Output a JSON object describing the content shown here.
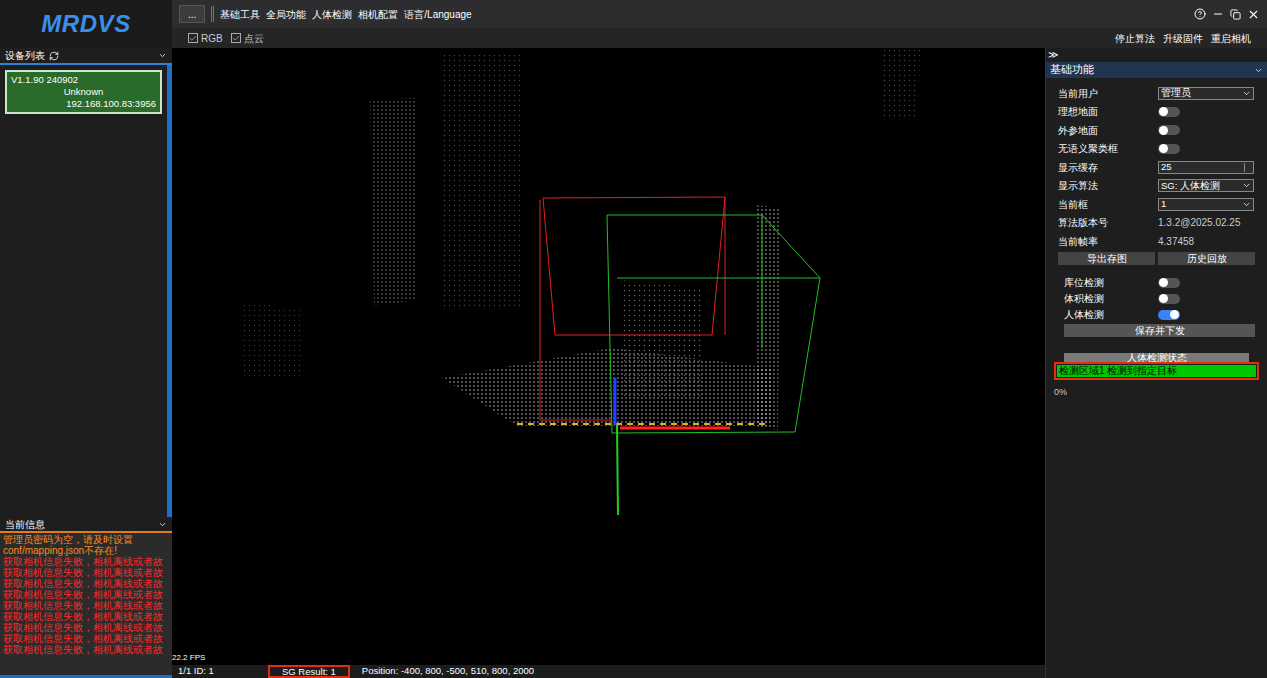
{
  "logo": "MRDVS",
  "device_list": {
    "title": "设备列表",
    "devices": [
      {
        "lines": [
          "V1.1.90 240902",
          "Unknown",
          "192.168.100.83:3956"
        ],
        "selected": true
      }
    ]
  },
  "log": {
    "title": "当前信息",
    "lines": [
      {
        "text": "管理员密码为空，请及时设置",
        "color": "#ff8a1c"
      },
      {
        "text": "conf/mapping.json不存在!",
        "color": "#ff8a1c"
      },
      {
        "text": "获取相机信息失败，相机离线或者故",
        "color": "#ff2a2a"
      },
      {
        "text": "获取相机信息失败，相机离线或者故",
        "color": "#ff2a2a"
      },
      {
        "text": "获取相机信息失败，相机离线或者故",
        "color": "#ff2a2a"
      },
      {
        "text": "获取相机信息失败，相机离线或者故",
        "color": "#ff2a2a"
      },
      {
        "text": "获取相机信息失败，相机离线或者故",
        "color": "#ff2a2a"
      },
      {
        "text": "获取相机信息失败，相机离线或者故",
        "color": "#ff2a2a"
      },
      {
        "text": "获取相机信息失败，相机离线或者故",
        "color": "#ff2a2a"
      },
      {
        "text": "获取相机信息失败，相机离线或者故",
        "color": "#ff2a2a"
      },
      {
        "text": "获取相机信息失败，相机离线或者故",
        "color": "#ff2a2a"
      }
    ]
  },
  "menu": {
    "more_button": "...",
    "items": [
      "基础工具",
      "全局功能",
      "人体检测",
      "相机配置",
      "语言/Language"
    ]
  },
  "view_options": [
    {
      "label": "RGB",
      "checked": true
    },
    {
      "label": "点云",
      "checked": true
    }
  ],
  "actions": [
    "停止算法",
    "升级固件",
    "重启相机"
  ],
  "viewport": {
    "fps": "22.2 FPS"
  },
  "status_bar": {
    "id": "1/1 ID: 1",
    "result": "SG Result: 1",
    "position": "Position: -400, 800, -500, 510, 800, 2000"
  },
  "panel": {
    "collapse": "≫",
    "title": "基础功能",
    "rows": [
      {
        "label": "当前用户",
        "kind": "select",
        "value": "管理员"
      },
      {
        "label": "理想地面",
        "kind": "toggle",
        "on": false
      },
      {
        "label": "外参地面",
        "kind": "toggle",
        "on": false
      },
      {
        "label": "无语义聚类框",
        "kind": "toggle",
        "on": false
      },
      {
        "label": "显示缓存",
        "kind": "spin",
        "value": "25"
      },
      {
        "label": "显示算法",
        "kind": "select",
        "value": "SG: 人体检测"
      },
      {
        "label": "当前框",
        "kind": "select",
        "value": "1"
      },
      {
        "label": "算法版本号",
        "kind": "value",
        "value": "1.3.2@2025.02.25"
      },
      {
        "label": "当前帧率",
        "kind": "value",
        "value": "4.37458"
      }
    ],
    "buttons": [
      "导出存图",
      "历史回放"
    ],
    "detections": [
      {
        "label": "库位检测",
        "on": false
      },
      {
        "label": "体积检测",
        "on": false
      },
      {
        "label": "人体检测",
        "on": true
      }
    ],
    "save": "保存并下发",
    "status_title": "人体检测状态",
    "status": {
      "text": "检测区域1 检测到指定目标",
      "color": "#00c800"
    },
    "progress": "0%"
  }
}
